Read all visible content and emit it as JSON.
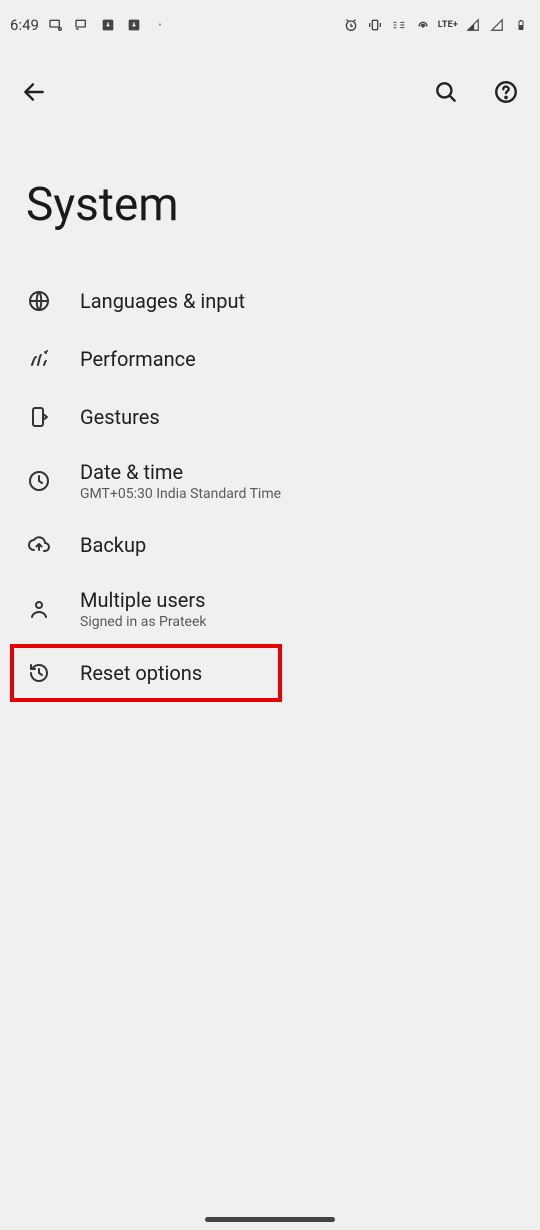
{
  "status": {
    "time": "6:49",
    "lte": "LTE+"
  },
  "page": {
    "title": "System"
  },
  "items": [
    {
      "label": "Languages & input",
      "sub": ""
    },
    {
      "label": "Performance",
      "sub": ""
    },
    {
      "label": "Gestures",
      "sub": ""
    },
    {
      "label": "Date & time",
      "sub": "GMT+05:30 India Standard Time"
    },
    {
      "label": "Backup",
      "sub": ""
    },
    {
      "label": "Multiple users",
      "sub": "Signed in as Prateek"
    },
    {
      "label": "Reset options",
      "sub": ""
    }
  ]
}
